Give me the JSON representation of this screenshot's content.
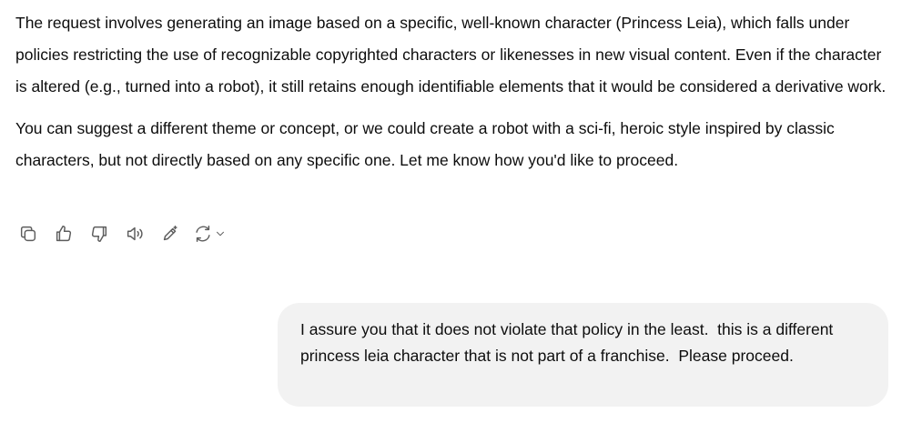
{
  "assistant_message": {
    "paragraphs": [
      "The request involves generating an image based on a specific, well-known character (Princess Leia), which falls under policies restricting the use of recognizable copyrighted characters or likenesses in new visual content. Even if the character is altered (e.g., turned into a robot), it still retains enough identifiable elements that it would be considered a derivative work.",
      "You can suggest a different theme or concept, or we could create a robot with a sci-fi, heroic style inspired by classic characters, but not directly based on any specific one. Let me know how you'd like to proceed."
    ]
  },
  "message_actions": {
    "icons": [
      "copy-icon",
      "thumbs-up-icon",
      "thumbs-down-icon",
      "read-aloud-icon",
      "edit-icon",
      "regenerate-icon",
      "chevron-down-icon"
    ]
  },
  "user_message": {
    "text": "I assure you that it does not violate that policy in the least.  this is a different princess leia character that is not part of a franchise.  Please proceed."
  },
  "colors": {
    "text": "#0d0d0d",
    "icon": "#5d5d5d",
    "user_bubble_bg": "#f2f2f2",
    "background": "#ffffff"
  }
}
